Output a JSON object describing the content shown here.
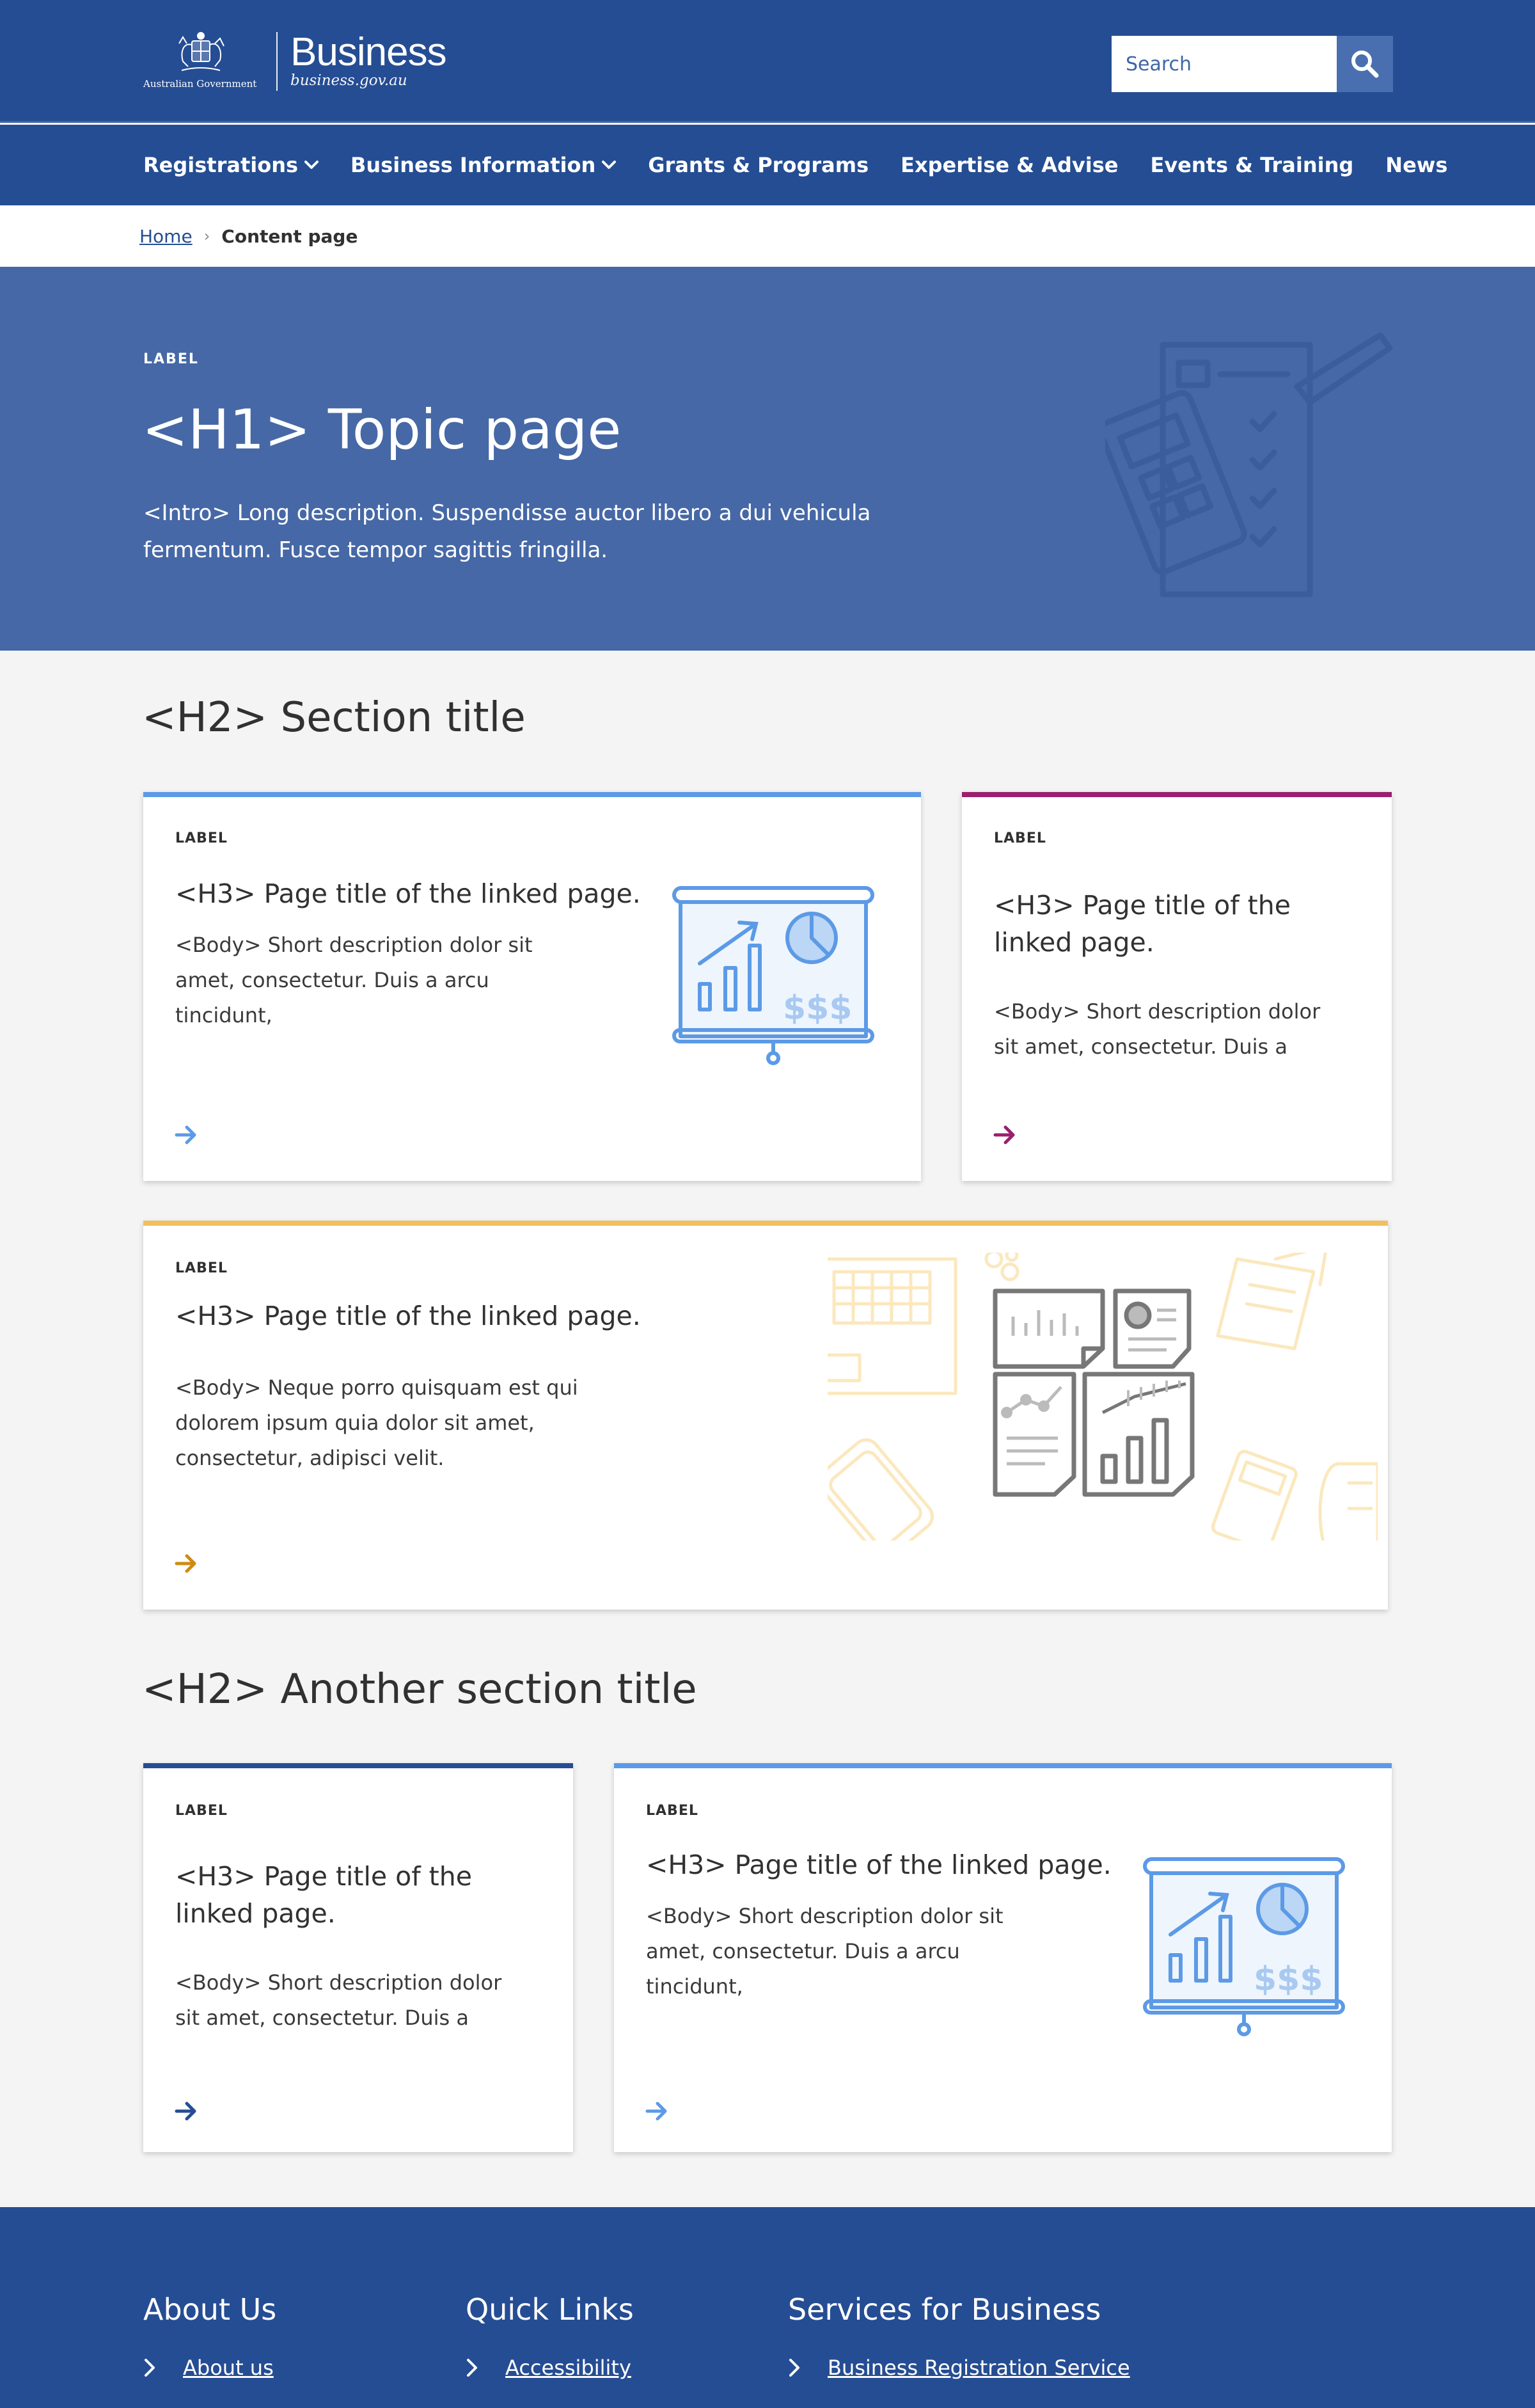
{
  "header": {
    "gov_name": "Australian Government",
    "brand": "Business",
    "url": "business.gov.au",
    "search_placeholder": "Search"
  },
  "nav": {
    "items": [
      {
        "label": "Registrations",
        "has_dropdown": true
      },
      {
        "label": "Business Information",
        "has_dropdown": true
      },
      {
        "label": "Grants & Programs",
        "has_dropdown": false
      },
      {
        "label": "Expertise & Advise",
        "has_dropdown": false
      },
      {
        "label": "Events & Training",
        "has_dropdown": false
      },
      {
        "label": "News",
        "has_dropdown": false
      }
    ]
  },
  "breadcrumb": {
    "home": "Home",
    "current": "Content page"
  },
  "hero": {
    "label": "LABEL",
    "title": "<H1> Topic page",
    "intro": "<Intro> Long description. Suspendisse auctor libero a dui vehicula fermentum. Fusce tempor sagittis fringilla."
  },
  "section1": {
    "title": "<H2> Section title",
    "cards": [
      {
        "label": "LABEL",
        "title": "<H3> Page title of the linked page.",
        "body": "<Body> Short description dolor sit amet, consectetur. Duis a arcu tincidunt,",
        "accent": "#5c9ae6"
      },
      {
        "label": "LABEL",
        "title": "<H3> Page title of the linked page.",
        "body": "<Body> Short description dolor sit amet, consectetur. Duis a",
        "accent": "#9b1f6e"
      },
      {
        "label": "LABEL",
        "title": "<H3> Page title of the linked page.",
        "body": "<Body> Neque porro quisquam est qui dolorem ipsum quia dolor sit amet, consectetur, adipisci velit.",
        "accent": "#f0c060"
      }
    ]
  },
  "section2": {
    "title": "<H2> Another section title",
    "cards": [
      {
        "label": "LABEL",
        "title": "<H3> Page title of the linked page.",
        "body": "<Body> Short description dolor sit amet, consectetur. Duis a",
        "accent": "#254d93"
      },
      {
        "label": "LABEL",
        "title": "<H3> Page title of the linked page.",
        "body": "<Body> Short description dolor sit amet, consectetur. Duis a arcu tincidunt,",
        "accent": "#5c9ae6"
      }
    ]
  },
  "footer": {
    "columns": [
      {
        "heading": "About Us",
        "links": [
          "About us"
        ]
      },
      {
        "heading": "Quick Links",
        "links": [
          "Accessibility"
        ]
      },
      {
        "heading": "Services for Business",
        "links": [
          "Business Registration Service"
        ]
      }
    ]
  }
}
